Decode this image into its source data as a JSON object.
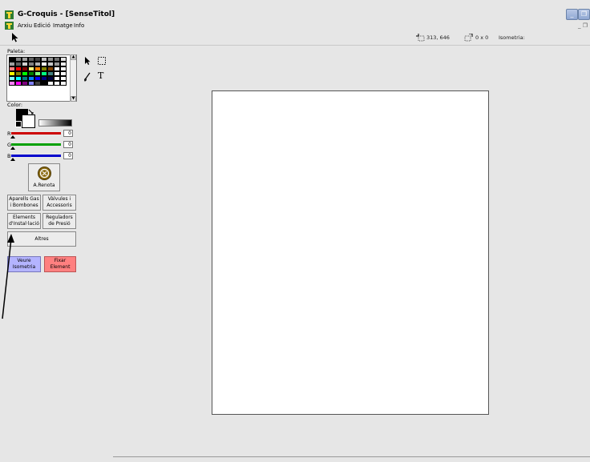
{
  "window": {
    "title": "G-Croquis - [SenseTitol]",
    "controls": {
      "minimize": "_",
      "restore": "❐"
    }
  },
  "menu": {
    "items": [
      "Arxiu",
      "Edició",
      "Imatge",
      "Info"
    ],
    "mdi_controls": "_ ❐"
  },
  "status": {
    "position": "313, 646",
    "size": "0 x 0",
    "mode": "Isometria:"
  },
  "sidebar": {
    "palette_label": "Paleta:",
    "palette_colors": [
      "#000000",
      "#808080",
      "#a0a0a0",
      "#606060",
      "#404040",
      "#c0c0c0",
      "#909090",
      "#707070",
      "#e0e0e0",
      "#a0a0a0",
      "#606060",
      "#d0d0d0",
      "#808080",
      "#b0b0b0",
      "#ffffff",
      "#c8c8c8",
      "#989898",
      "#f0f0f0",
      "#ff8080",
      "#ff0000",
      "#800000",
      "#ffff80",
      "#ff8000",
      "#808000",
      "#804000",
      "#ffffff",
      "#ffffff",
      "#ffff00",
      "#808000",
      "#00ff00",
      "#008000",
      "#80ff80",
      "#00ff80",
      "#408080",
      "#ffffff",
      "#ffffff",
      "#80ffff",
      "#00ffff",
      "#008080",
      "#0080ff",
      "#0000ff",
      "#000080",
      "#000040",
      "#ffffff",
      "#ffffff",
      "#ff80ff",
      "#ff00ff",
      "#800080",
      "#8080ff",
      "#404040",
      "#000000",
      "#ffffff",
      "#ffffff",
      "#ffffff"
    ],
    "tools": {
      "pointer": "↖",
      "select": "⬚",
      "brush": "✍",
      "text": "T"
    },
    "color_label": "Color:",
    "channels": [
      {
        "label": "R",
        "value": "0",
        "color": "#cc0000"
      },
      {
        "label": "G",
        "value": "0",
        "color": "#00a000"
      },
      {
        "label": "B",
        "value": "0",
        "color": "#0000cc"
      }
    ],
    "logo_label": "A.Renota",
    "buttons": {
      "gas": "Aparells Gas i Bombones",
      "valves": "Vàlvules i Accessoris",
      "elements": "Elements d'Instal·lació",
      "regulators": "Reguladors de Presió",
      "others": "Altres",
      "isometry": "Veure Isometria",
      "fix": "Fixar Element"
    },
    "button_colors": {
      "isometry": "#b4b4ff",
      "fix": "#ff8080"
    }
  }
}
